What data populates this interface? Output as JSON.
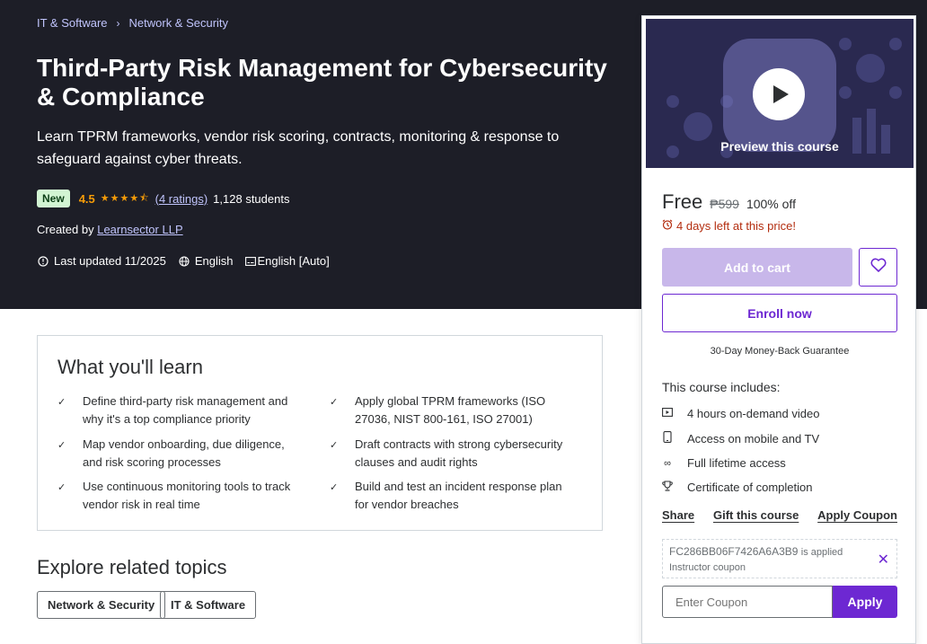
{
  "breadcrumb": {
    "items": [
      "IT & Software",
      "Network & Security"
    ]
  },
  "course": {
    "title": "Third-Party Risk Management for Cybersecurity & Compliance",
    "subtitle": "Learn TPRM frameworks, vendor risk scoring, contracts, monitoring & response to safeguard against cyber threats.",
    "badge": "New",
    "rating": "4.5",
    "stars": 4.5,
    "ratings_link": "(4 ratings)",
    "students": "1,128 students",
    "created_by_label": "Created by",
    "instructor": "Learnsector LLP",
    "last_updated": "Last updated 11/2025",
    "language": "English",
    "captions": "English [Auto]"
  },
  "learn": {
    "heading": "What you'll learn",
    "items": [
      "Define third-party risk management and why it's a top compliance priority",
      "Apply global TPRM frameworks (ISO 27036, NIST 800-161, ISO 27001)",
      "Map vendor onboarding, due diligence, and risk scoring processes",
      "Draft contracts with strong cybersecurity clauses and audit rights",
      "Use continuous monitoring tools to track vendor risk in real time",
      "Build and test an incident response plan for vendor breaches"
    ]
  },
  "explore": {
    "heading": "Explore related topics",
    "topics": [
      "Network & Security",
      "IT & Software"
    ]
  },
  "sidebar": {
    "preview_label": "Preview this course",
    "price": "Free",
    "old_price": "₱599",
    "discount": "100% off",
    "deadline": "4 days left at this price!",
    "add_to_cart": "Add to cart",
    "enroll": "Enroll now",
    "guarantee": "30-Day Money-Back Guarantee",
    "includes_title": "This course includes:",
    "includes": [
      {
        "icon": "video-icon",
        "label": "4 hours on-demand video"
      },
      {
        "icon": "mobile-icon",
        "label": "Access on mobile and TV"
      },
      {
        "icon": "infinity-icon",
        "label": "Full lifetime access"
      },
      {
        "icon": "trophy-icon",
        "label": "Certificate of completion"
      }
    ],
    "share": "Share",
    "gift": "Gift this course",
    "apply_coupon": "Apply Coupon",
    "coupon_code": "FC286BB06F7426A6A3B9",
    "coupon_applied": "is applied",
    "coupon_note": "Instructor coupon",
    "coupon_placeholder": "Enter Coupon",
    "apply": "Apply"
  },
  "colors": {
    "hero_bg": "#1d1e27",
    "accent": "#6d28d2",
    "link": "#c0c4fc",
    "star": "#f69c08",
    "alert": "#b32d0f",
    "badge_bg": "#d2f4d3"
  }
}
